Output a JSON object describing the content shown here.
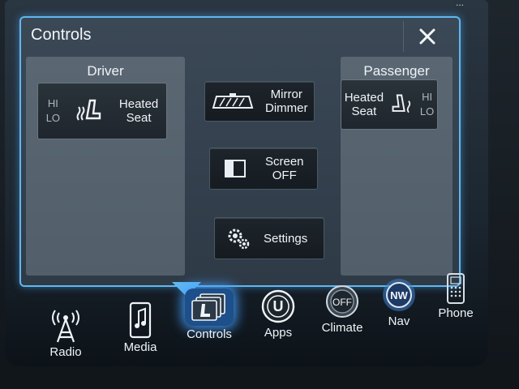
{
  "map": {
    "hint_text": "..."
  },
  "popup": {
    "title": "Controls",
    "driver": {
      "title": "Driver",
      "seat": {
        "hi": "HI",
        "lo": "LO",
        "label_line1": "Heated",
        "label_line2": "Seat"
      }
    },
    "passenger": {
      "title": "Passenger",
      "seat": {
        "hi": "HI",
        "lo": "LO",
        "label_line1": "Heated",
        "label_line2": "Seat"
      }
    },
    "mirror": {
      "line1": "Mirror",
      "line2": "Dimmer"
    },
    "screen": {
      "line1": "Screen",
      "line2": "OFF"
    },
    "settings": {
      "label": "Settings"
    }
  },
  "nav": {
    "radio": "Radio",
    "media": "Media",
    "controls": "Controls",
    "apps": "Apps",
    "apps_u": "U",
    "climate": "Climate",
    "climate_off": "OFF",
    "nav": "Nav",
    "nav_dir": "NW",
    "phone": "Phone"
  },
  "colors": {
    "accent": "#5fb8f0",
    "panel": "#566370",
    "button": "#1f262d"
  },
  "icons": {
    "close": "close-icon",
    "heated_seat": "heated-seat-icon",
    "mirror": "mirror-dimmer-icon",
    "screen": "screen-off-icon",
    "settings": "gear-icon",
    "radio": "radio-tower-icon",
    "media": "music-phone-icon",
    "controls": "controls-icon",
    "apps": "apps-icon",
    "climate": "climate-icon",
    "nav": "compass-icon",
    "phone": "phone-icon"
  }
}
